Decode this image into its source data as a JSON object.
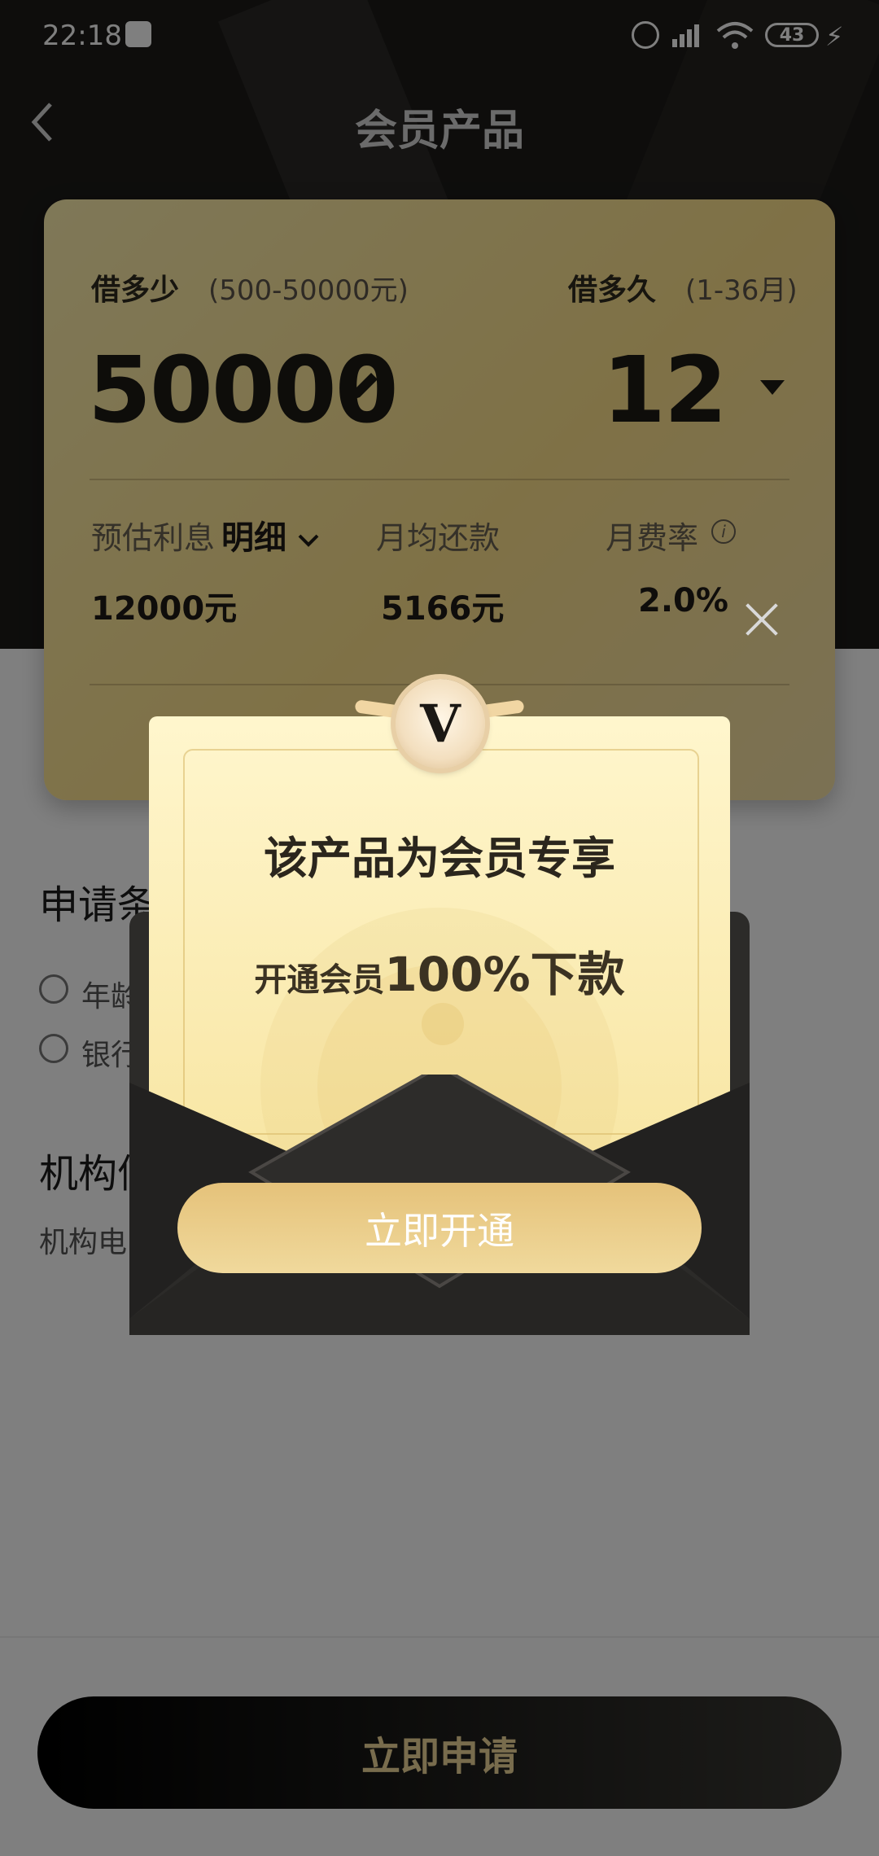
{
  "status_bar": {
    "time": "22:18",
    "app_icon": "s-app-icon",
    "battery": "43",
    "icons": [
      "alarm-icon",
      "signal-icon",
      "wifi-icon",
      "battery-icon",
      "charging-icon"
    ]
  },
  "header": {
    "title": "会员产品",
    "back_icon": "chevron-left-icon"
  },
  "card": {
    "amount_label": "借多少",
    "amount_range": "(500-50000元)",
    "amount_value": "50000",
    "term_label": "借多久",
    "term_range": "(1-36月)",
    "term_value": "12",
    "interest_label": "预估利息",
    "detail_label": "明细",
    "monthly_label": "月均还款",
    "rate_label": "月费率",
    "interest_value": "12000元",
    "monthly_value": "5166元",
    "rate_value": "2.0%"
  },
  "background_sections": {
    "apply_title": "申请条",
    "item1": "年龄",
    "item2": "银行",
    "org_title": "机构信",
    "org_desc": "机构电"
  },
  "bottom": {
    "apply_button": "立即申请"
  },
  "modal": {
    "badge_letter": "V",
    "title": "该产品为会员专享",
    "subtitle_small": "开通会员",
    "subtitle_big": "100%下款",
    "button": "立即开通"
  }
}
